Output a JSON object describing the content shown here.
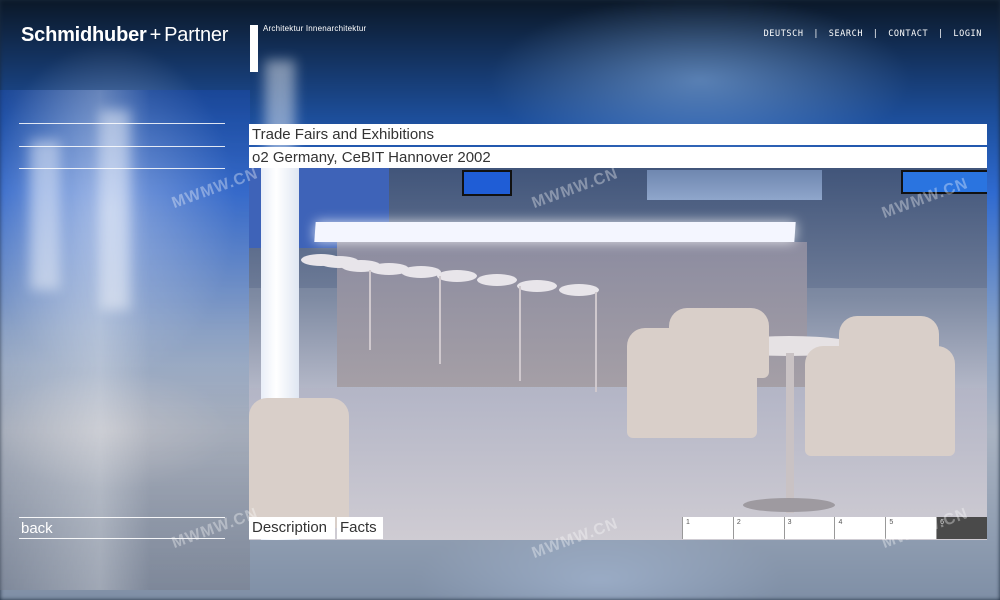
{
  "brand": {
    "name_bold": "Schmidhuber",
    "plus": "+",
    "name_light": "Partner",
    "tagline": "Architektur  Innenarchitektur"
  },
  "topnav": {
    "items": [
      "DEUTSCH",
      "SEARCH",
      "CONTACT",
      "LOGIN"
    ],
    "separator": "|"
  },
  "content": {
    "category": "Trade Fairs and Exhibitions",
    "project": "o2 Germany, CeBIT Hannover 2002"
  },
  "bottom": {
    "back_label": "back",
    "description_label": "Description",
    "facts_label": "Facts",
    "pages": [
      "1",
      "2",
      "3",
      "4",
      "5",
      "6"
    ],
    "active_page": 6
  },
  "watermarks": [
    "MWMW.CN",
    "MWMW.CN",
    "MWMW.CN",
    "MWMW.CN",
    "MWMW.CN",
    "MWMW.CN"
  ],
  "colors": {
    "accent_white": "#ffffff",
    "active_page_bg": "#4a4a4a",
    "background_blue": "#2f6ad0"
  }
}
